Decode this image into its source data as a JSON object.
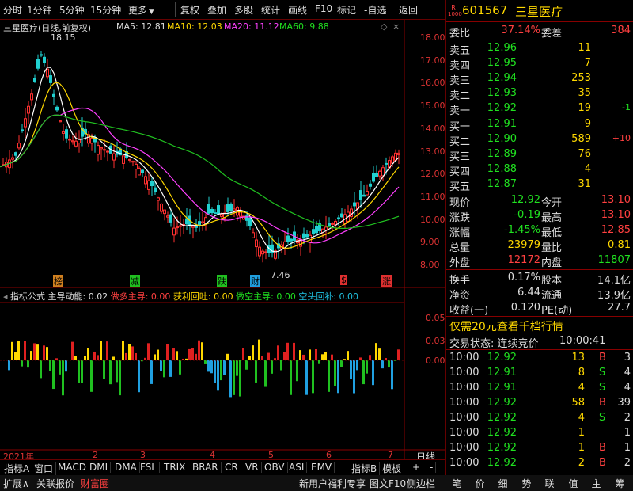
{
  "toolbar": {
    "items": [
      "分时",
      "1分钟",
      "5分钟",
      "15分钟",
      "更多",
      "复权",
      "叠加",
      "多股",
      "统计",
      "画线",
      "F10",
      "标记",
      "-自选",
      "返回"
    ]
  },
  "kline": {
    "title": "三星医疗(日线,前复权)",
    "ma5": "MA5: 12.81",
    "ma10": "MA10: 12.03",
    "ma20": "MA20: 11.12",
    "ma60": "MA60: 9.88",
    "high_label": "18.15",
    "low_label": "7.46",
    "y_ticks": [
      "18.00",
      "17.00",
      "16.00",
      "15.00",
      "14.00",
      "13.00",
      "12.00",
      "11.00",
      "10.00",
      "9.00",
      "8.00"
    ],
    "markers": [
      "榜",
      "减",
      "跌",
      "财",
      "$",
      "涨"
    ]
  },
  "indicator": {
    "title": "指标公式",
    "line1": "主导动能: 0.02",
    "line2": "做多主导: 0.00",
    "line3": "获利回吐: 0.00",
    "line4": "做空主导: 0.00",
    "line5": "空头回补: 0.00",
    "y_ticks": [
      "0.05",
      "0.03",
      "0.00"
    ]
  },
  "xaxis": {
    "labels": [
      "2021年",
      "2",
      "3",
      "4",
      "5",
      "6",
      "7"
    ],
    "right": "日线"
  },
  "tabs": [
    "指标A",
    "窗口",
    "MACD",
    "DMI",
    "DMA",
    "FSL",
    "TRIX",
    "BRAR",
    "CR",
    "VR",
    "OBV",
    "ASI",
    "EMV",
    "指标B",
    "模板",
    "+",
    "-"
  ],
  "statusbar": {
    "left1": "扩展∧",
    "left2": "关联报价",
    "left3": "财富圈",
    "right1": "新用户福利专享",
    "right2": "图文F10",
    "right3": "侧边栏"
  },
  "stock": {
    "code": "601567",
    "name": "三星医疗",
    "badge": "R"
  },
  "book": {
    "weibi_label": "委比",
    "weibi": "37.14%",
    "weicha_label": "委差",
    "weicha": "384",
    "asks": [
      {
        "label": "卖五",
        "price": "12.96",
        "vol": "11",
        "chg": ""
      },
      {
        "label": "卖四",
        "price": "12.95",
        "vol": "7",
        "chg": ""
      },
      {
        "label": "卖三",
        "price": "12.94",
        "vol": "253",
        "chg": ""
      },
      {
        "label": "卖二",
        "price": "12.93",
        "vol": "35",
        "chg": ""
      },
      {
        "label": "卖一",
        "price": "12.92",
        "vol": "19",
        "chg": "-1"
      }
    ],
    "bids": [
      {
        "label": "买一",
        "price": "12.91",
        "vol": "9",
        "chg": ""
      },
      {
        "label": "买二",
        "price": "12.90",
        "vol": "589",
        "chg": "+10"
      },
      {
        "label": "买三",
        "price": "12.89",
        "vol": "76",
        "chg": ""
      },
      {
        "label": "买四",
        "price": "12.88",
        "vol": "4",
        "chg": ""
      },
      {
        "label": "买五",
        "price": "12.87",
        "vol": "31",
        "chg": ""
      }
    ]
  },
  "quote": [
    {
      "l1": "现价",
      "v1": "12.92",
      "l2": "今开",
      "v2": "13.10"
    },
    {
      "l1": "涨跌",
      "v1": "-0.19",
      "l2": "最高",
      "v2": "13.10"
    },
    {
      "l1": "涨幅",
      "v1": "-1.45%",
      "l2": "最低",
      "v2": "12.85"
    },
    {
      "l1": "总量",
      "v1": "23979",
      "l2": "量比",
      "v2": "0.81"
    },
    {
      "l1": "外盘",
      "v1": "12172",
      "l2": "内盘",
      "v2": "11807"
    }
  ],
  "stats": [
    {
      "l1": "换手",
      "v1": "0.17%",
      "l2": "股本",
      "v2": "14.1亿"
    },
    {
      "l1": "净资",
      "v1": "6.44",
      "l2": "流通",
      "v2": "13.9亿"
    },
    {
      "l1": "收益(一)",
      "v1": "0.120",
      "l2": "PE(动)",
      "v2": "27.7"
    }
  ],
  "promo": "仅需20元查看千档行情",
  "trade_status": {
    "label": "交易状态: 连续竞价",
    "time": "10:00:41"
  },
  "ticks": [
    {
      "t": "10:00",
      "p": "12.92",
      "v": "13",
      "s": "B",
      "n": "3"
    },
    {
      "t": "10:00",
      "p": "12.91",
      "v": "8",
      "s": "S",
      "n": "4"
    },
    {
      "t": "10:00",
      "p": "12.91",
      "v": "4",
      "s": "S",
      "n": "4"
    },
    {
      "t": "10:00",
      "p": "12.92",
      "v": "58",
      "s": "B",
      "n": "39"
    },
    {
      "t": "10:00",
      "p": "12.92",
      "v": "4",
      "s": "S",
      "n": "2"
    },
    {
      "t": "10:00",
      "p": "12.92",
      "v": "1",
      "s": "",
      "n": "1"
    },
    {
      "t": "10:00",
      "p": "12.92",
      "v": "1",
      "s": "B",
      "n": "1"
    },
    {
      "t": "10:00",
      "p": "12.92",
      "v": "2",
      "s": "B",
      "n": "2"
    }
  ],
  "panel_tabs": [
    "笔",
    "价",
    "细",
    "势",
    "联",
    "值",
    "主",
    "筹"
  ]
}
